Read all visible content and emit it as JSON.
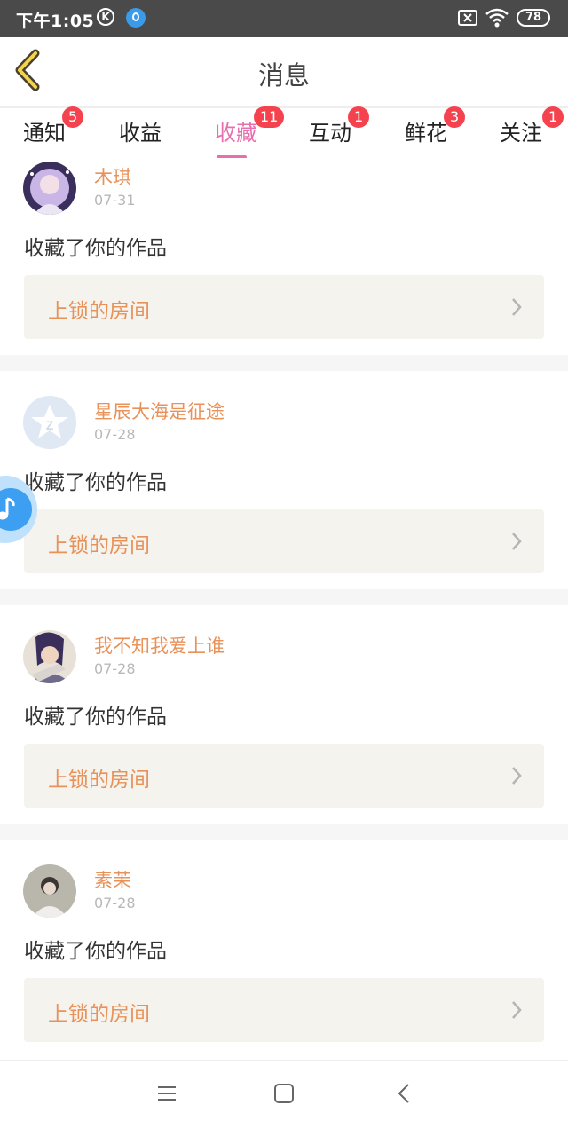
{
  "status_bar": {
    "time": "下午1:05",
    "k_icon_letter": "K",
    "battery": "78"
  },
  "header": {
    "title": "消息",
    "back_icon": "chevron-left-icon"
  },
  "tabs": [
    {
      "label": "通知",
      "badge": "5",
      "active": false
    },
    {
      "label": "收益",
      "badge": "",
      "active": false
    },
    {
      "label": "收藏",
      "badge": "11",
      "active": true
    },
    {
      "label": "互动",
      "badge": "1",
      "active": false
    },
    {
      "label": "鲜花",
      "badge": "3",
      "active": false
    },
    {
      "label": "关注",
      "badge": "1",
      "active": false
    }
  ],
  "messages": [
    {
      "user": "木琪",
      "date": "07-31",
      "action": "收藏了你的作品",
      "work": "上锁的房间"
    },
    {
      "user": "星辰大海是征途",
      "date": "07-28",
      "action": "收藏了你的作品",
      "work": "上锁的房间"
    },
    {
      "user": "我不知我爱上谁",
      "date": "07-28",
      "action": "收藏了你的作品",
      "work": "上锁的房间"
    },
    {
      "user": "素茉",
      "date": "07-28",
      "action": "收藏了你的作品",
      "work": "上锁的房间"
    }
  ],
  "colors": {
    "accent_pink": "#e86fae",
    "name_orange": "#e8925a",
    "badge_red": "#f5424f",
    "card_bg": "#f4f3ee"
  }
}
